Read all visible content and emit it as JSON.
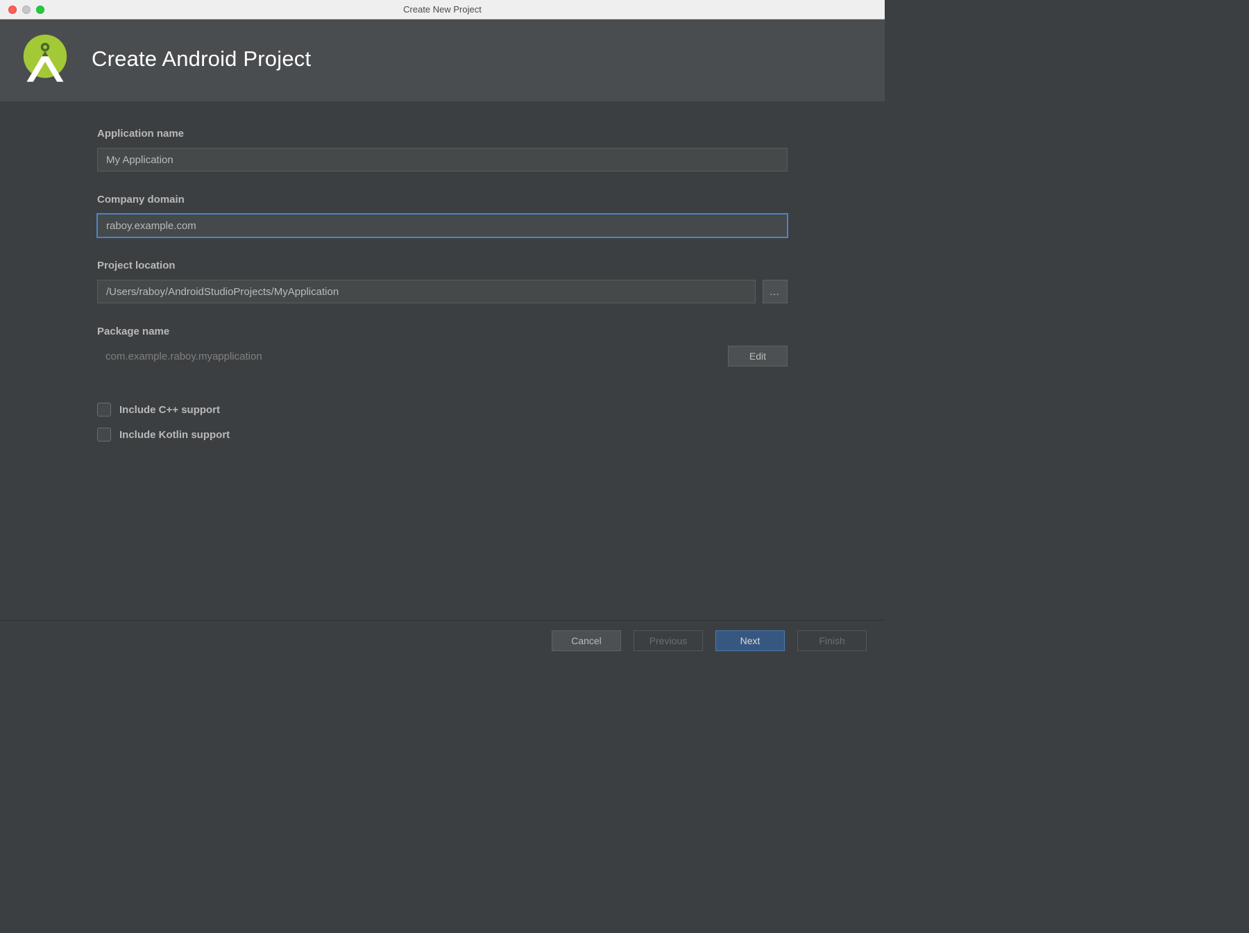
{
  "window": {
    "title": "Create New Project"
  },
  "banner": {
    "title": "Create Android Project"
  },
  "form": {
    "application_name": {
      "label": "Application name",
      "value": "My Application"
    },
    "company_domain": {
      "label": "Company domain",
      "value": "raboy.example.com"
    },
    "project_location": {
      "label": "Project location",
      "value": "/Users/raboy/AndroidStudioProjects/MyApplication",
      "browse_label": "…"
    },
    "package_name": {
      "label": "Package name",
      "value": "com.example.raboy.myapplication",
      "edit_label": "Edit"
    },
    "cpp_support": {
      "label": "Include C++ support",
      "checked": false
    },
    "kotlin_support": {
      "label": "Include Kotlin support",
      "checked": false
    }
  },
  "footer": {
    "cancel": "Cancel",
    "previous": "Previous",
    "next": "Next",
    "finish": "Finish"
  },
  "colors": {
    "accent": "#365880",
    "focus_border": "#4a86c7",
    "logo_green": "#a4c936"
  }
}
